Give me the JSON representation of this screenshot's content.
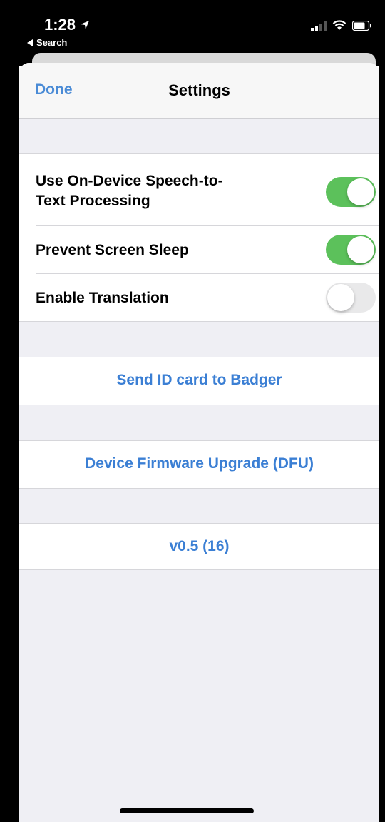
{
  "status_bar": {
    "time": "1:28",
    "back_label": "Search",
    "location_icon": "location-arrow-icon",
    "signal_icon": "cellular-signal-icon",
    "wifi_icon": "wifi-icon",
    "battery_icon": "battery-icon"
  },
  "navbar": {
    "done_label": "Done",
    "title": "Settings"
  },
  "settings": {
    "items": [
      {
        "label_line1": "Use On-Device Speech-to-",
        "label_line2": "Text Processing",
        "enabled": true
      },
      {
        "label": "Prevent Screen Sleep",
        "enabled": true
      },
      {
        "label": "Enable Translation",
        "enabled": false
      }
    ]
  },
  "actions": {
    "send_id_label": "Send ID card to Badger",
    "dfu_label": "Device Firmware Upgrade (DFU)",
    "version_label": "v0.5 (16)"
  },
  "colors": {
    "accent": "#3b7fd4",
    "toggle_on": "#5cc15b",
    "toggle_off": "#e9e9ea",
    "group_bg": "#efeff4"
  }
}
